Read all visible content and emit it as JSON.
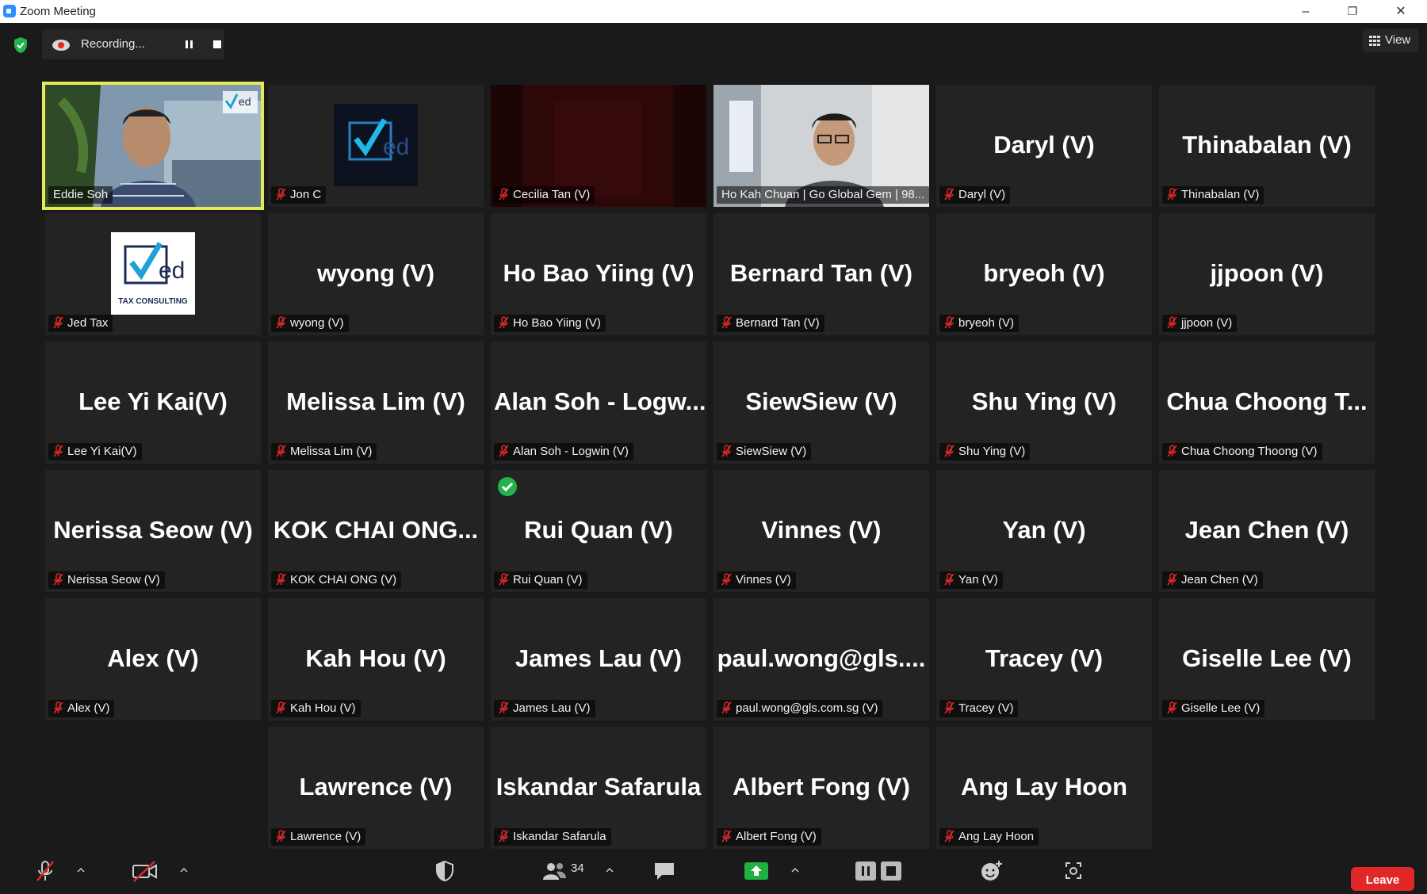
{
  "window": {
    "title": "Zoom Meeting",
    "minimize_glyph": "–",
    "restore_glyph": "❐",
    "close_glyph": "✕"
  },
  "topbar": {
    "recording_label": "Recording...",
    "view_label": "View"
  },
  "colors": {
    "active_speaker_border": "#e4e957",
    "muted_mic": "#e02828",
    "leave_button": "#e02828",
    "share_screen": "#1fb141",
    "encryption_shield": "#23b24b"
  },
  "tiles": [
    {
      "tag": "Eddie Soh",
      "muted": false,
      "type": "video-man-plants",
      "active": true
    },
    {
      "tag": "Jon C",
      "muted": true,
      "type": "logo-dark"
    },
    {
      "tag": "Cecilia Tan (V)",
      "muted": true,
      "type": "video-dark-red"
    },
    {
      "tag": "Ho Kah Chuan | Go Global Gem | 98...",
      "muted": false,
      "type": "video-man-office"
    },
    {
      "big": "Daryl (V)",
      "tag": "Daryl (V)",
      "muted": true
    },
    {
      "big": "Thinabalan (V)",
      "tag": "Thinabalan (V)",
      "muted": true
    },
    {
      "tag": "Jed Tax",
      "muted": true,
      "type": "logo-light",
      "logo_text": "TAX CONSULTING"
    },
    {
      "big": "wyong (V)",
      "tag": "wyong (V)",
      "muted": true
    },
    {
      "big": "Ho Bao Yiing (V)",
      "tag": "Ho Bao Yiing (V)",
      "muted": true
    },
    {
      "big": "Bernard Tan (V)",
      "tag": "Bernard Tan (V)",
      "muted": true
    },
    {
      "big": "bryeoh (V)",
      "tag": "bryeoh (V)",
      "muted": true
    },
    {
      "big": "jjpoon (V)",
      "tag": "jjpoon (V)",
      "muted": true
    },
    {
      "big": "Lee Yi Kai(V)",
      "tag": "Lee Yi Kai(V)",
      "muted": true
    },
    {
      "big": "Melissa Lim (V)",
      "tag": "Melissa Lim (V)",
      "muted": true
    },
    {
      "big": "Alan Soh - Logw...",
      "tag": "Alan Soh - Logwin (V)",
      "muted": true
    },
    {
      "big": "SiewSiew (V)",
      "tag": "SiewSiew (V)",
      "muted": true
    },
    {
      "big": "Shu Ying (V)",
      "tag": "Shu Ying (V)",
      "muted": true
    },
    {
      "big": "Chua Choong T...",
      "tag": "Chua Choong Thoong (V)",
      "muted": true
    },
    {
      "big": "Nerissa Seow (V)",
      "tag": "Nerissa Seow (V)",
      "muted": true
    },
    {
      "big": "KOK CHAI ONG...",
      "tag": "KOK CHAI ONG (V)",
      "muted": true
    },
    {
      "big": "Rui Quan (V)",
      "tag": "Rui Quan (V)",
      "muted": true,
      "reaction": "checkmark"
    },
    {
      "big": "Vinnes (V)",
      "tag": "Vinnes (V)",
      "muted": true
    },
    {
      "big": "Yan (V)",
      "tag": "Yan (V)",
      "muted": true
    },
    {
      "big": "Jean Chen (V)",
      "tag": "Jean Chen (V)",
      "muted": true
    },
    {
      "big": "Alex (V)",
      "tag": "Alex (V)",
      "muted": true
    },
    {
      "big": "Kah Hou (V)",
      "tag": "Kah Hou (V)",
      "muted": true
    },
    {
      "big": "James Lau (V)",
      "tag": "James Lau (V)",
      "muted": true
    },
    {
      "big": "paul.wong@gls....",
      "tag": "paul.wong@gls.com.sg (V)",
      "muted": true
    },
    {
      "big": "Tracey (V)",
      "tag": "Tracey (V)",
      "muted": true
    },
    {
      "big": "Giselle Lee (V)",
      "tag": "Giselle Lee (V)",
      "muted": true
    },
    {
      "big": "Lawrence (V)",
      "tag": "Lawrence (V)",
      "muted": true
    },
    {
      "big": "Iskandar Safarula",
      "tag": "Iskandar Safarula",
      "muted": true
    },
    {
      "big": "Albert Fong (V)",
      "tag": "Albert Fong (V)",
      "muted": true
    },
    {
      "big": "Ang Lay Hoon",
      "tag": "Ang Lay Hoon",
      "muted": true
    }
  ],
  "toolbar": {
    "participant_count": "34",
    "leave_label": "Leave"
  },
  "icons": {
    "mic": "mic-muted-icon",
    "video": "video-off-icon",
    "security": "security-shield-icon",
    "participants": "participants-icon",
    "chat": "chat-icon",
    "share": "share-screen-icon",
    "record": "record-controls-icon",
    "reactions": "reactions-icon",
    "apps": "apps-icon"
  }
}
